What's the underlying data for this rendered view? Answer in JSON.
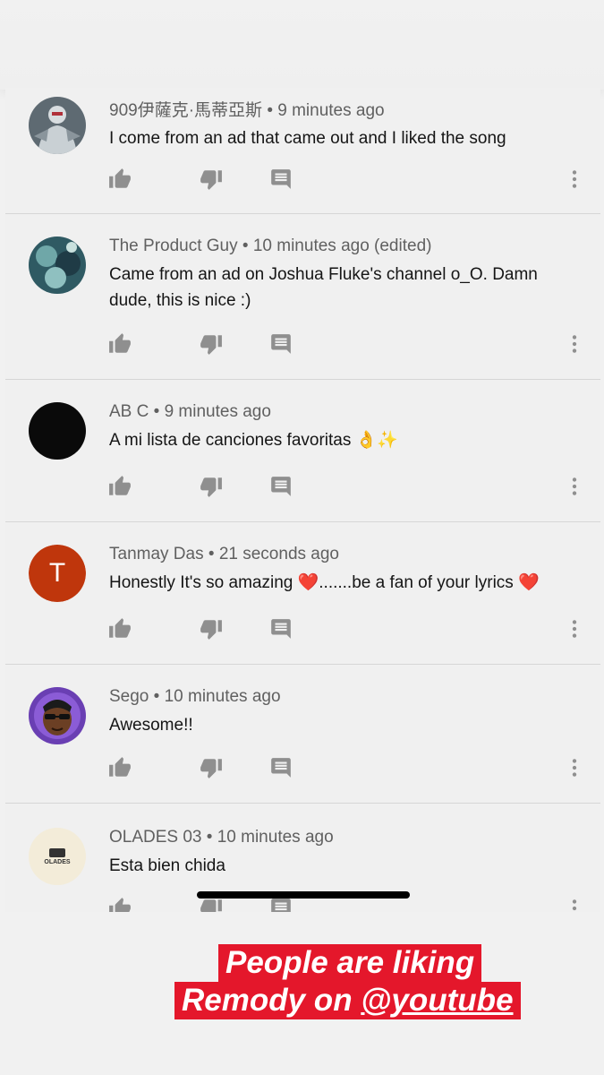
{
  "comments": [
    {
      "author": "909伊薩克·馬蒂亞斯",
      "time": "9 minutes ago",
      "text": "I come from an ad that came out and I liked the song"
    },
    {
      "author": "The Product Guy",
      "time": "10 minutes ago (edited)",
      "text": "Came from an ad on Joshua Fluke's channel o_O. Damn dude, this is nice :)"
    },
    {
      "author": "AB C",
      "time": "9 minutes ago",
      "text": "A mi lista de canciones favoritas 👌✨"
    },
    {
      "author": "Tanmay Das",
      "time": "21 seconds ago",
      "text": "Honestly It's so amazing ❤️.......be a fan of your lyrics ❤️",
      "avatar_letter": "T",
      "avatar_color": "#bf360c"
    },
    {
      "author": "Sego",
      "time": "10 minutes ago",
      "text": "Awesome!!"
    },
    {
      "author": "OLADES 03",
      "time": "10 minutes ago",
      "text": "Esta bien chida",
      "avatar_text": "OLADES"
    }
  ],
  "separator": "•",
  "caption": {
    "line1": "People are liking",
    "line2_prefix": "Remody on ",
    "line2_handle": "@youtube",
    "background": "#e4172b"
  },
  "icons": {
    "like": "thumb-up-icon",
    "dislike": "thumb-down-icon",
    "reply": "reply-comment-icon",
    "more": "more-vertical-icon"
  }
}
